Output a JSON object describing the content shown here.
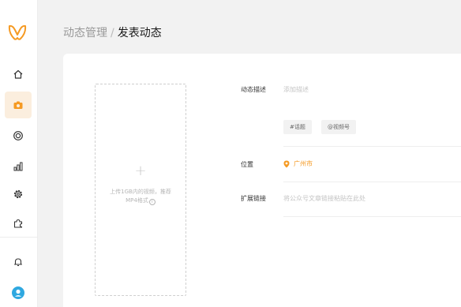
{
  "sidebar": {
    "brand_color": "#f59a23",
    "items": [
      {
        "icon": "home-icon"
      },
      {
        "icon": "camera-icon",
        "active": true
      },
      {
        "icon": "circle-target-icon"
      },
      {
        "icon": "bar-chart-icon"
      },
      {
        "icon": "gear-icon"
      },
      {
        "icon": "puzzle-icon"
      }
    ],
    "bottom": [
      {
        "icon": "bell-icon"
      },
      {
        "icon": "user-avatar-icon"
      }
    ]
  },
  "breadcrumb": {
    "parent": "动态管理",
    "separator": "/",
    "current": "发表动态"
  },
  "upload": {
    "plus": "+",
    "tip_line1": "上传1GB内的视频，推荐",
    "tip_line2": "MP4格式",
    "info": "i"
  },
  "form": {
    "description": {
      "label": "动态描述",
      "placeholder": "添加描述"
    },
    "tags": {
      "topic": "#话题",
      "channel": "@视频号"
    },
    "location": {
      "label": "位置",
      "value": "广州市"
    },
    "link": {
      "label": "扩展链接",
      "placeholder": "将公众号文章链接粘贴在此处"
    }
  }
}
